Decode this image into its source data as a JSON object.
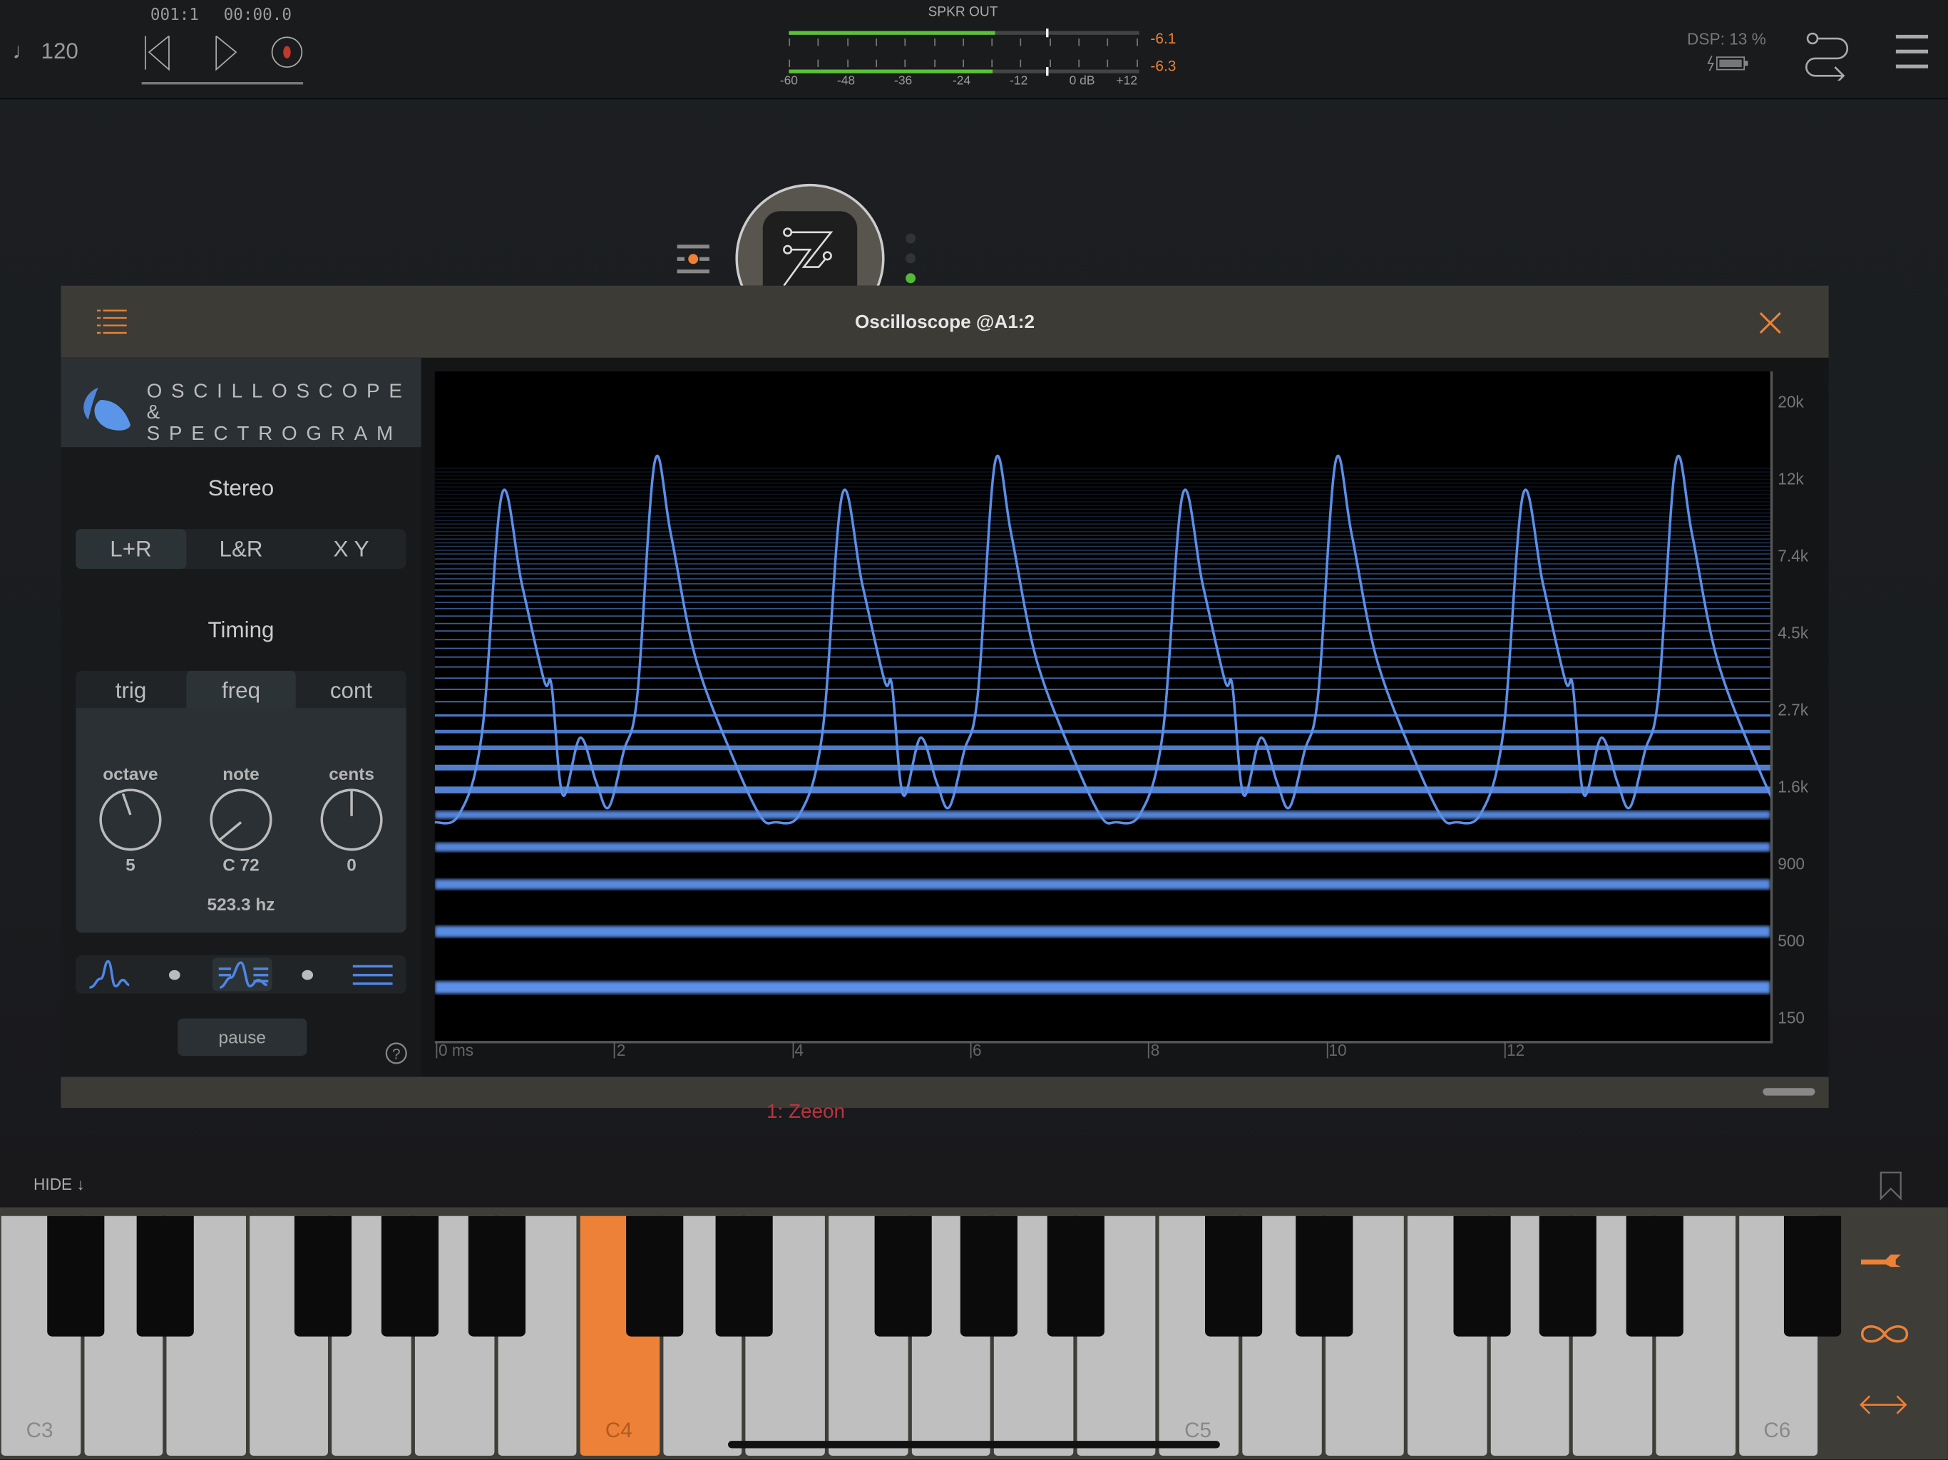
{
  "topbar": {
    "tempo": "♩ 120",
    "position": "001:1",
    "time": "00:00.0",
    "meter_title": "SPKR OUT",
    "meter_scale": [
      "-60",
      "-48",
      "-36",
      "-24",
      "-12",
      "0 dB",
      "+12"
    ],
    "meter_left": "-6.1",
    "meter_right": "-6.3",
    "meter_level_fraction": 0.6,
    "dsp": "DSP: 13 %"
  },
  "node": {
    "status_dots": [
      "off",
      "off",
      "on"
    ]
  },
  "window": {
    "title": "Oscilloscope @A1:2",
    "footer_label": "1: Zeeon"
  },
  "plugin": {
    "logo_line1": "OSCILLOSCOPE",
    "logo_line2": "& SPECTROGRAM",
    "stereo_title": "Stereo",
    "stereo_modes": [
      "L+R",
      "L&R",
      "X Y"
    ],
    "stereo_selected": "L+R",
    "timing_title": "Timing",
    "timing_tabs": [
      "trig",
      "freq",
      "cont"
    ],
    "timing_selected": "freq",
    "knobs": [
      {
        "label": "octave",
        "value": "5"
      },
      {
        "label": "note",
        "value": "C 72"
      },
      {
        "label": "cents",
        "value": "0"
      }
    ],
    "frequency": "523.3 hz",
    "view_modes": [
      "waveform",
      "waveform+spectrogram",
      "spectrogram"
    ],
    "view_selected": "waveform+spectrogram",
    "pause_label": "pause"
  },
  "scope": {
    "freq_labels": [
      "20k",
      "12k",
      "7.4k",
      "4.5k",
      "2.7k",
      "1.6k",
      "900",
      "500",
      "150"
    ],
    "time_labels": [
      "0 ms",
      "2",
      "4",
      "6",
      "8",
      "10",
      "12"
    ],
    "trace_color": "#5b8fe8"
  },
  "keyboard": {
    "hide_label": "HIDE ↓",
    "white_labels": {
      "0": "C3",
      "7": "C4",
      "14": "C5",
      "21": "C6"
    },
    "active_key": "C4",
    "accent": "#ec8137"
  }
}
